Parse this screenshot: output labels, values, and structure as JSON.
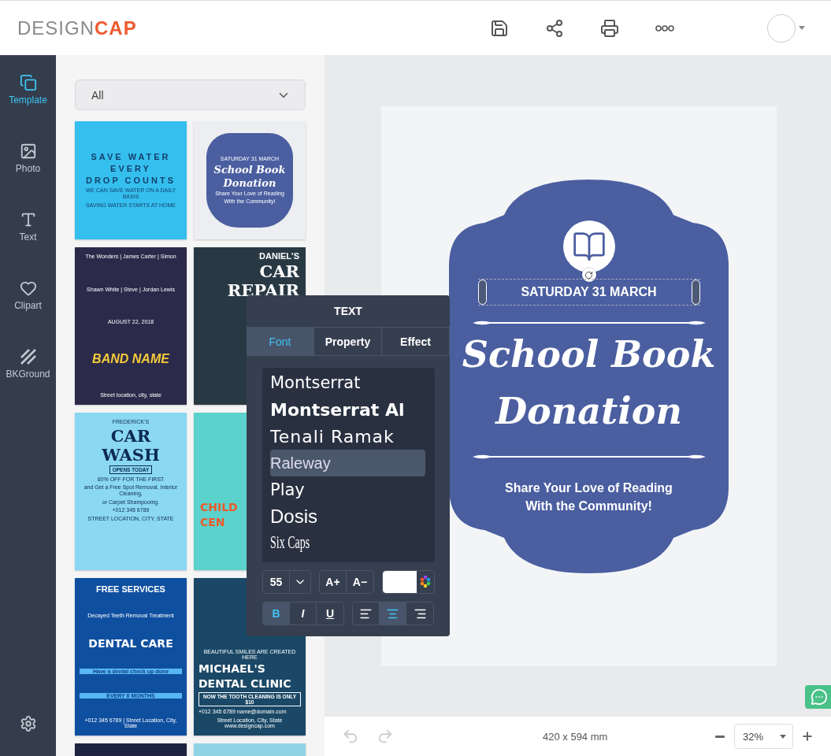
{
  "header": {
    "logo": {
      "text": "DESIGN",
      "accent": "CAP"
    }
  },
  "sidebar": {
    "items": [
      {
        "kind": "template",
        "label": "Template",
        "selected": true
      },
      {
        "kind": "photo",
        "label": "Photo",
        "selected": false
      },
      {
        "kind": "text",
        "label": "Text",
        "selected": false
      },
      {
        "kind": "clipart",
        "label": "Clipart",
        "selected": false
      },
      {
        "kind": "background",
        "label": "BKGround",
        "selected": false
      }
    ]
  },
  "template_panel": {
    "filter": {
      "value": "All"
    },
    "templates": [
      {
        "kind": "water",
        "lines": [
          {
            "kind": "spaced",
            "text": "SAVE WATER"
          },
          {
            "kind": "spaced",
            "text": "EVERY"
          },
          {
            "kind": "spaced",
            "text": "DROP COUNTS"
          },
          {
            "kind": "tiny",
            "text": "WE CAN SAVE WATER ON A DAILY BASIS"
          },
          {
            "kind": "tiny",
            "text": "SAVING WATER STARTS AT HOME"
          }
        ]
      },
      {
        "kind": "book",
        "lines": [
          {
            "kind": "tiny",
            "text": "SATURDAY 31 MARCH"
          },
          {
            "kind": "script",
            "text": "School Book"
          },
          {
            "kind": "script",
            "text": "Donation"
          },
          {
            "kind": "tiny",
            "text": "Share Your Love of Reading"
          },
          {
            "kind": "tiny",
            "text": "With the Community!"
          }
        ]
      },
      {
        "kind": "band",
        "lines": [
          {
            "kind": "tiny",
            "text": "The Wonders | James Carter | Simon"
          },
          {
            "kind": "tiny",
            "text": "Shawn White | Steve | Jordan Lewis"
          },
          {
            "kind": "tiny",
            "text": "AUGUST 22, 2018"
          },
          {
            "kind": "display",
            "text": "BAND NAME"
          },
          {
            "kind": "tiny",
            "text": "Street location, city, state"
          }
        ]
      },
      {
        "kind": "repair",
        "lines": [
          {
            "kind": "small",
            "text": "DANIEL'S"
          },
          {
            "kind": "big",
            "text": "CAR"
          },
          {
            "kind": "big",
            "text": "REPAIR"
          }
        ]
      },
      {
        "kind": "wash",
        "lines": [
          {
            "kind": "tiny",
            "text": "FREDERICK'S"
          },
          {
            "kind": "big",
            "text": "CAR"
          },
          {
            "kind": "big",
            "text": "WASH"
          },
          {
            "kind": "tag",
            "text": "OPENS TODAY"
          },
          {
            "kind": "tiny",
            "text": "60% OFF FOR THE FIRST"
          },
          {
            "kind": "tiny",
            "text": "and Get a Free Spot Removal, Interior Cleaning,"
          },
          {
            "kind": "tiny",
            "text": "or Carpet Shampooing."
          },
          {
            "kind": "tiny",
            "text": "+012 345 6789"
          },
          {
            "kind": "tiny",
            "text": "STREET LOCATION, CITY, STATE"
          }
        ]
      },
      {
        "kind": "children",
        "lines": [
          {
            "kind": "medium",
            "text": "CHILD"
          },
          {
            "kind": "medium",
            "text": "CEN"
          }
        ]
      },
      {
        "kind": "dental",
        "lines": [
          {
            "kind": "small",
            "text": "FREE SERVICES"
          },
          {
            "kind": "tiny",
            "text": "Decayed Teeth Removal Treatment"
          },
          {
            "kind": "medium",
            "text": "DENTAL CARE"
          },
          {
            "kind": "band",
            "text": "Have a dental check up done"
          },
          {
            "kind": "band",
            "text": "EVERY 6 MONTHS"
          },
          {
            "kind": "tiny",
            "text": "+012 345 6789 | Street Location, City, State"
          }
        ]
      },
      {
        "kind": "clinic",
        "lines": [
          {
            "kind": "tiny",
            "text": "BEAUTIFUL SMILES ARE CREATED HERE"
          },
          {
            "kind": "medium",
            "text": "MICHAEL'S"
          },
          {
            "kind": "medium",
            "text": "DENTAL CLINIC"
          },
          {
            "kind": "tag",
            "text": "NOW THE TOOTH CLEANING IS ONLY $10"
          },
          {
            "kind": "tiny",
            "text": "+012 345 6789    name@domain.com"
          },
          {
            "kind": "tiny",
            "text": "Street Location, City, State    www.designcap.com"
          }
        ]
      },
      {
        "kind": "dark"
      },
      {
        "kind": "light"
      }
    ]
  },
  "poster": {
    "date": {
      "text": "SATURDAY 31 MARCH",
      "selected": true
    },
    "title": [
      "School Book",
      "Donation"
    ],
    "subtitle": [
      "Share Your Love of Reading",
      "With the Community!"
    ]
  },
  "text_panel": {
    "title": "TEXT",
    "tabs": [
      {
        "label": "Font",
        "selected": true
      },
      {
        "label": "Property",
        "selected": false
      },
      {
        "label": "Effect",
        "selected": false
      }
    ],
    "fonts": [
      {
        "kind": "sans",
        "label": "Montserrat",
        "selected": false
      },
      {
        "kind": "bold",
        "label": "Montserrat Al",
        "selected": false
      },
      {
        "kind": "wide",
        "label": "Tenali Ramak",
        "selected": false
      },
      {
        "kind": "light",
        "label": "Raleway",
        "selected": true
      },
      {
        "kind": "sans",
        "label": "Play",
        "selected": false
      },
      {
        "kind": "narrow",
        "label": "Dosis",
        "selected": false
      },
      {
        "kind": "caps",
        "label": "Six Caps",
        "selected": false
      }
    ],
    "size": "55",
    "grow": "A+",
    "shrink": "A−",
    "font_color": {
      "color": "#ffffff"
    },
    "styles": [
      {
        "label": "B",
        "on": true
      },
      {
        "label": "I",
        "on": false
      },
      {
        "label": "U",
        "on": false
      }
    ],
    "align": [
      {
        "kind": "left",
        "selected": false
      },
      {
        "kind": "center",
        "selected": true
      },
      {
        "kind": "right",
        "selected": false
      }
    ]
  },
  "footer": {
    "page_size": "420 x 594 mm",
    "zoom": "32%"
  }
}
